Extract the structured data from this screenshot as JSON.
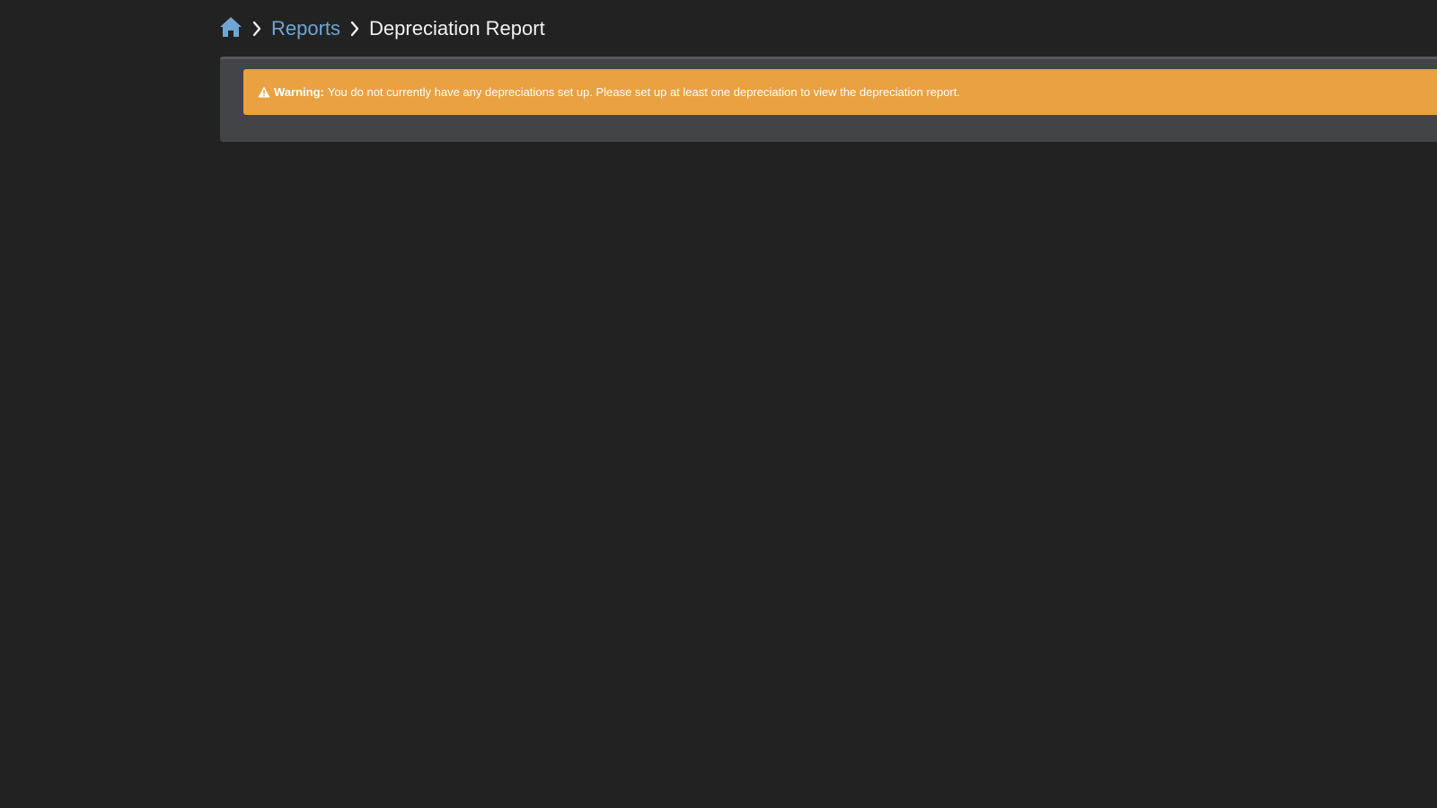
{
  "breadcrumb": {
    "home_icon": "home-icon",
    "separator_icon": "chevron-right-icon",
    "parent": "Reports",
    "current": "Depreciation Report"
  },
  "alert": {
    "icon": "warning-triangle-icon",
    "label": "Warning:",
    "message": "You do not currently have any depreciations set up. Please set up at least one depreciation to view the depreciation report."
  },
  "colors": {
    "background": "#222222",
    "panel": "#434447",
    "link": "#6fa6d6",
    "warning": "#e9a142",
    "text": "#f2f2f2"
  }
}
